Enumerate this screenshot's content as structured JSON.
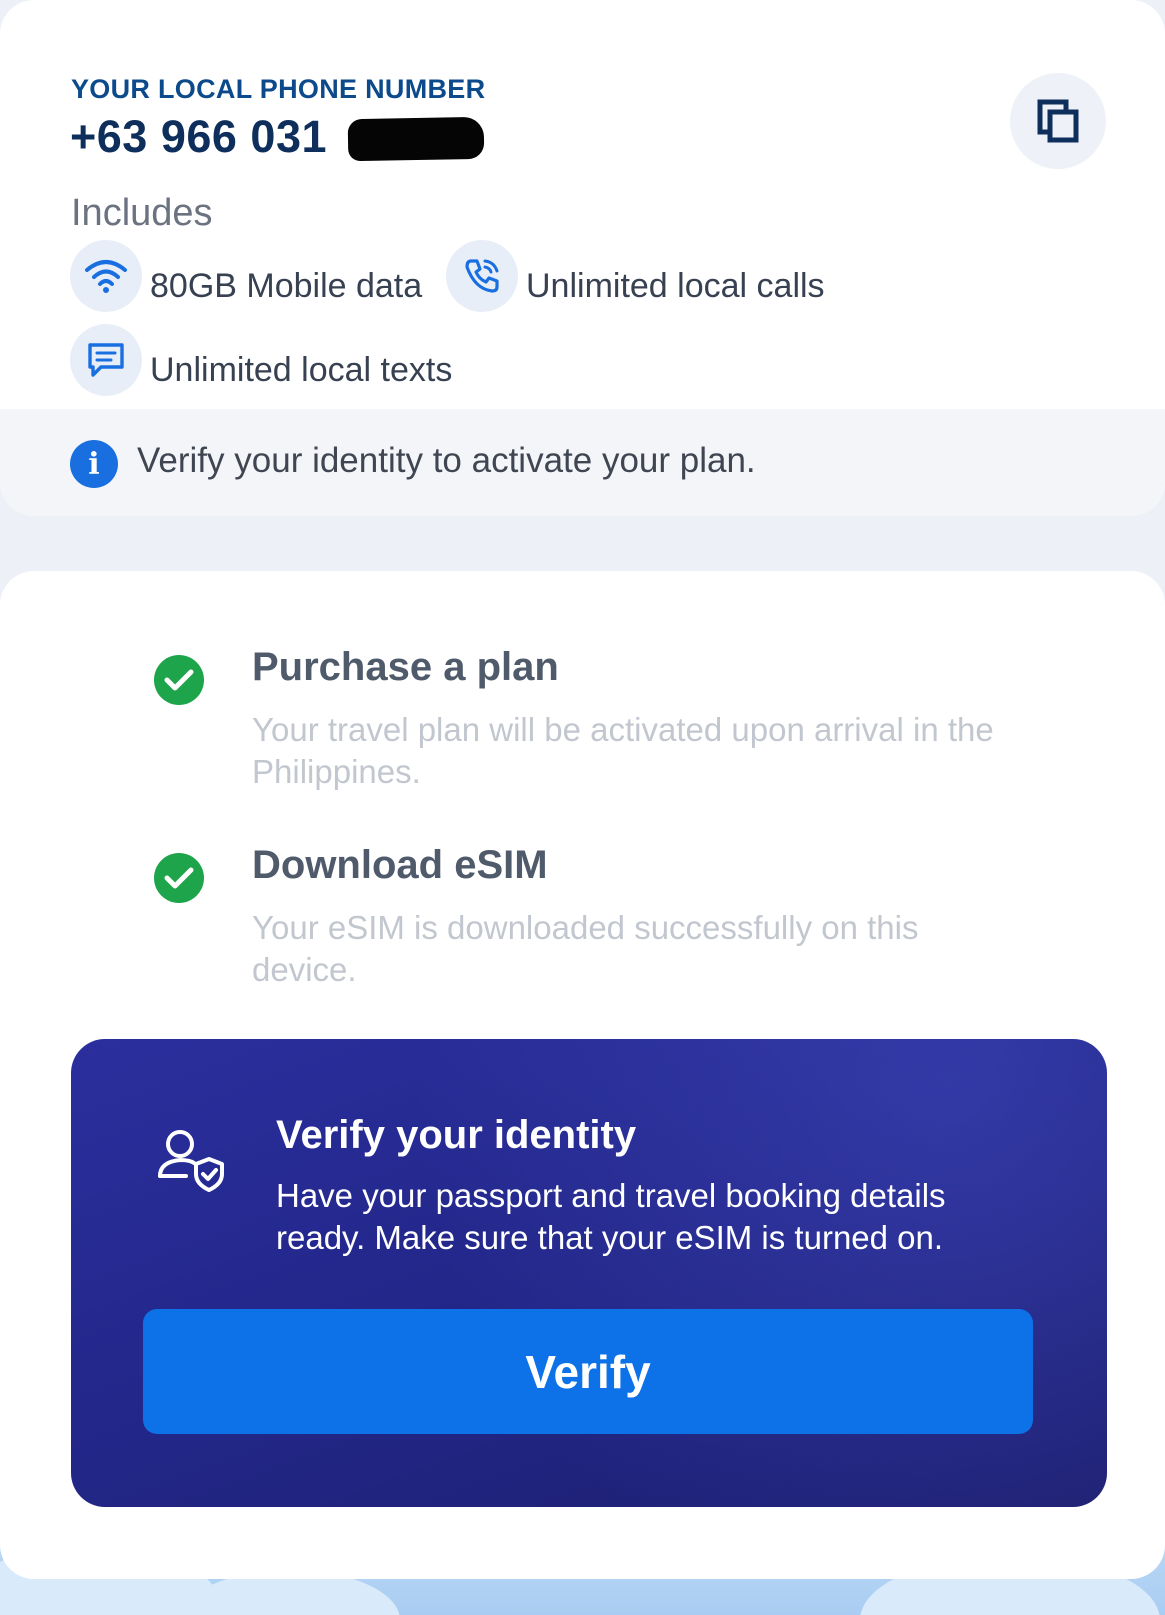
{
  "phone": {
    "label": "YOUR LOCAL PHONE NUMBER",
    "number": "+63 966 031"
  },
  "includes": {
    "heading": "Includes",
    "features": [
      {
        "icon": "wifi-icon",
        "label": "80GB Mobile data"
      },
      {
        "icon": "phone-call-icon",
        "label": "Unlimited local calls"
      },
      {
        "icon": "message-icon",
        "label": "Unlimited local texts"
      }
    ]
  },
  "notice": {
    "icon": "info-icon",
    "text": "Verify your identity to activate your plan."
  },
  "steps": [
    {
      "title": "Purchase a plan",
      "description": "Your travel plan will be activated upon arrival in the Philippines.",
      "status": "complete"
    },
    {
      "title": "Download eSIM",
      "description": "Your eSIM is downloaded successfully on this device.",
      "status": "complete"
    }
  ],
  "verify": {
    "icon": "user-shield-icon",
    "title": "Verify your identity",
    "description": "Have your passport and travel booking details ready. Make sure that your eSIM is turned on.",
    "button_label": "Verify"
  },
  "colors": {
    "brand_blue": "#0d72e8",
    "navy": "#0e2f5c",
    "banner": "#23278a",
    "success": "#1ea44a"
  }
}
